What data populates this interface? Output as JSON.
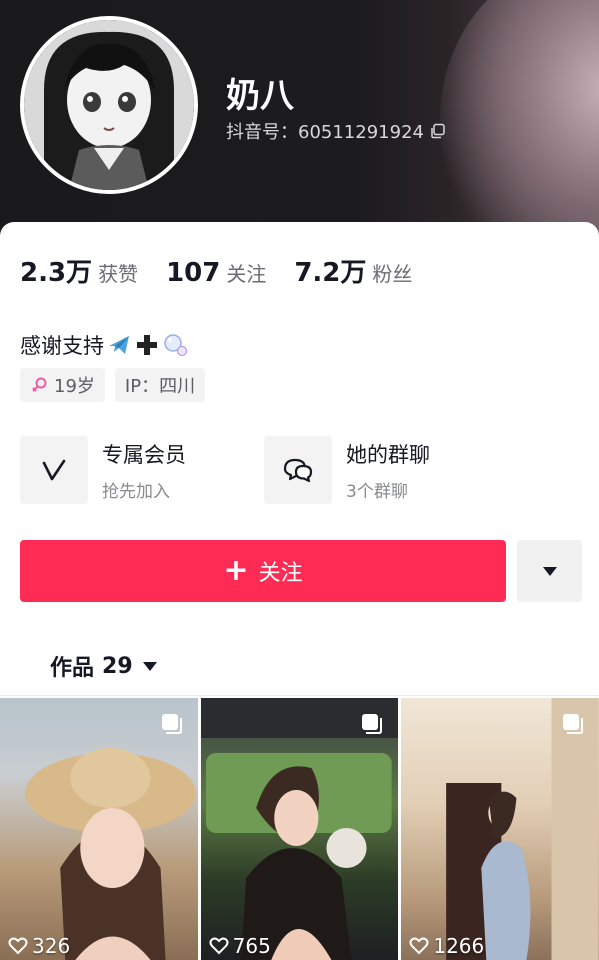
{
  "profile": {
    "display_name": "奶八",
    "douyin_id": "抖音号：60511291924"
  },
  "stats": [
    {
      "value": "2.3万",
      "label": "获赞"
    },
    {
      "value": "107",
      "label": "关注"
    },
    {
      "value": "7.2万",
      "label": "粉丝"
    }
  ],
  "bio": {
    "text": "感谢支持",
    "emojis": [
      "airplane-emoji",
      "plus-emoji",
      "bubbles-emoji"
    ]
  },
  "tags": [
    {
      "icon": "female-icon",
      "label": "19岁"
    },
    {
      "label": "IP：四川"
    }
  ],
  "features": [
    {
      "icon": "vip-v-icon",
      "title": "专属会员",
      "subtitle": "抢先加入"
    },
    {
      "icon": "group-chat-icon",
      "title": "她的群聊",
      "subtitle": "3个群聊"
    }
  ],
  "actions": {
    "follow_label": "关注",
    "follow_color": "#fe2c55",
    "more_icon": "caret-down-icon"
  },
  "works_tab": {
    "label": "作品",
    "count": "29"
  },
  "videos": [
    {
      "likes": "326"
    },
    {
      "likes": "765"
    },
    {
      "likes": "1266"
    }
  ],
  "colors": {
    "header_bg": "#1c1b1e",
    "accent": "#fe2c55"
  }
}
